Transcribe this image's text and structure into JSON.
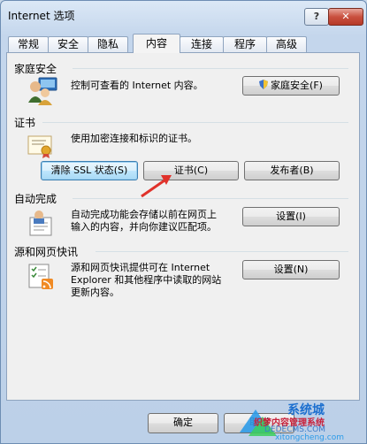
{
  "window": {
    "title": "Internet 选项",
    "help_label": "?",
    "close_label": "✕"
  },
  "tabs": [
    {
      "label": "常规"
    },
    {
      "label": "安全"
    },
    {
      "label": "隐私"
    },
    {
      "label": "内容",
      "active": true
    },
    {
      "label": "连接"
    },
    {
      "label": "程序"
    },
    {
      "label": "高级"
    }
  ],
  "family_safety": {
    "title": "家庭安全",
    "description": "控制可查看的 Internet 内容。",
    "button_label": "家庭安全(F)",
    "icon": "family-users-icon"
  },
  "certificates": {
    "title": "证书",
    "description": "使用加密连接和标识的证书。",
    "clear_ssl_label": "清除 SSL 状态(S)",
    "certificates_label": "证书(C)",
    "publishers_label": "发布者(B)",
    "icon": "certificate-icon"
  },
  "autocomplete": {
    "title": "自动完成",
    "description_line1": "自动完成功能会存储以前在网页上",
    "description_line2": "输入的内容，并向你建议匹配项。",
    "settings_label": "设置(I)",
    "icon": "autocomplete-icon"
  },
  "feeds": {
    "title": "源和网页快讯",
    "description_line1": "源和网页快讯提供可在 Internet",
    "description_line2": "Explorer 和其他程序中读取的网站",
    "description_line3": "更新内容。",
    "settings_label": "设置(N)",
    "icon": "feeds-icon"
  },
  "footer": {
    "ok_label": "确定",
    "cancel_label": "取消"
  },
  "watermark": {
    "line1": "系统城",
    "line2": "织梦内容管理系统",
    "line3": "DEDECMS.COM",
    "line4": "xitongcheng.com"
  },
  "colors": {
    "accent_arrow": "#e0322b",
    "title_bar": "#c4d6ec",
    "panel": "#f0f0f0"
  }
}
